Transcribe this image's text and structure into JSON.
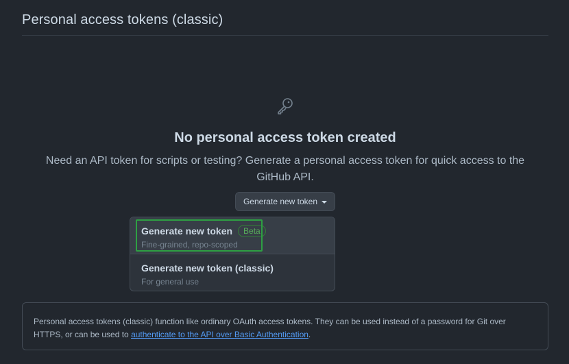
{
  "header": {
    "title": "Personal access tokens (classic)"
  },
  "blankslate": {
    "icon": "key-icon",
    "title": "No personal access token created",
    "description": "Need an API token for scripts or testing? Generate a personal access token for quick access to the GitHub API."
  },
  "generate_button": {
    "label": "Generate new token"
  },
  "menu": {
    "items": [
      {
        "title": "Generate new token",
        "badge": "Beta",
        "description": "Fine-grained, repo-scoped"
      },
      {
        "title": "Generate new token (classic)",
        "description": "For general use"
      }
    ]
  },
  "note": {
    "text_before": "Personal access tokens (classic) function like ordinary OAuth access tokens. They can be used instead of a password for Git over HTTPS, or can be used to ",
    "link_text": "authenticate to the API over Basic Authentication",
    "text_after": "."
  },
  "colors": {
    "background": "#22272e",
    "highlight_border": "#2ea043",
    "badge_green": "#57ab5a",
    "link_blue": "#539bf5"
  }
}
